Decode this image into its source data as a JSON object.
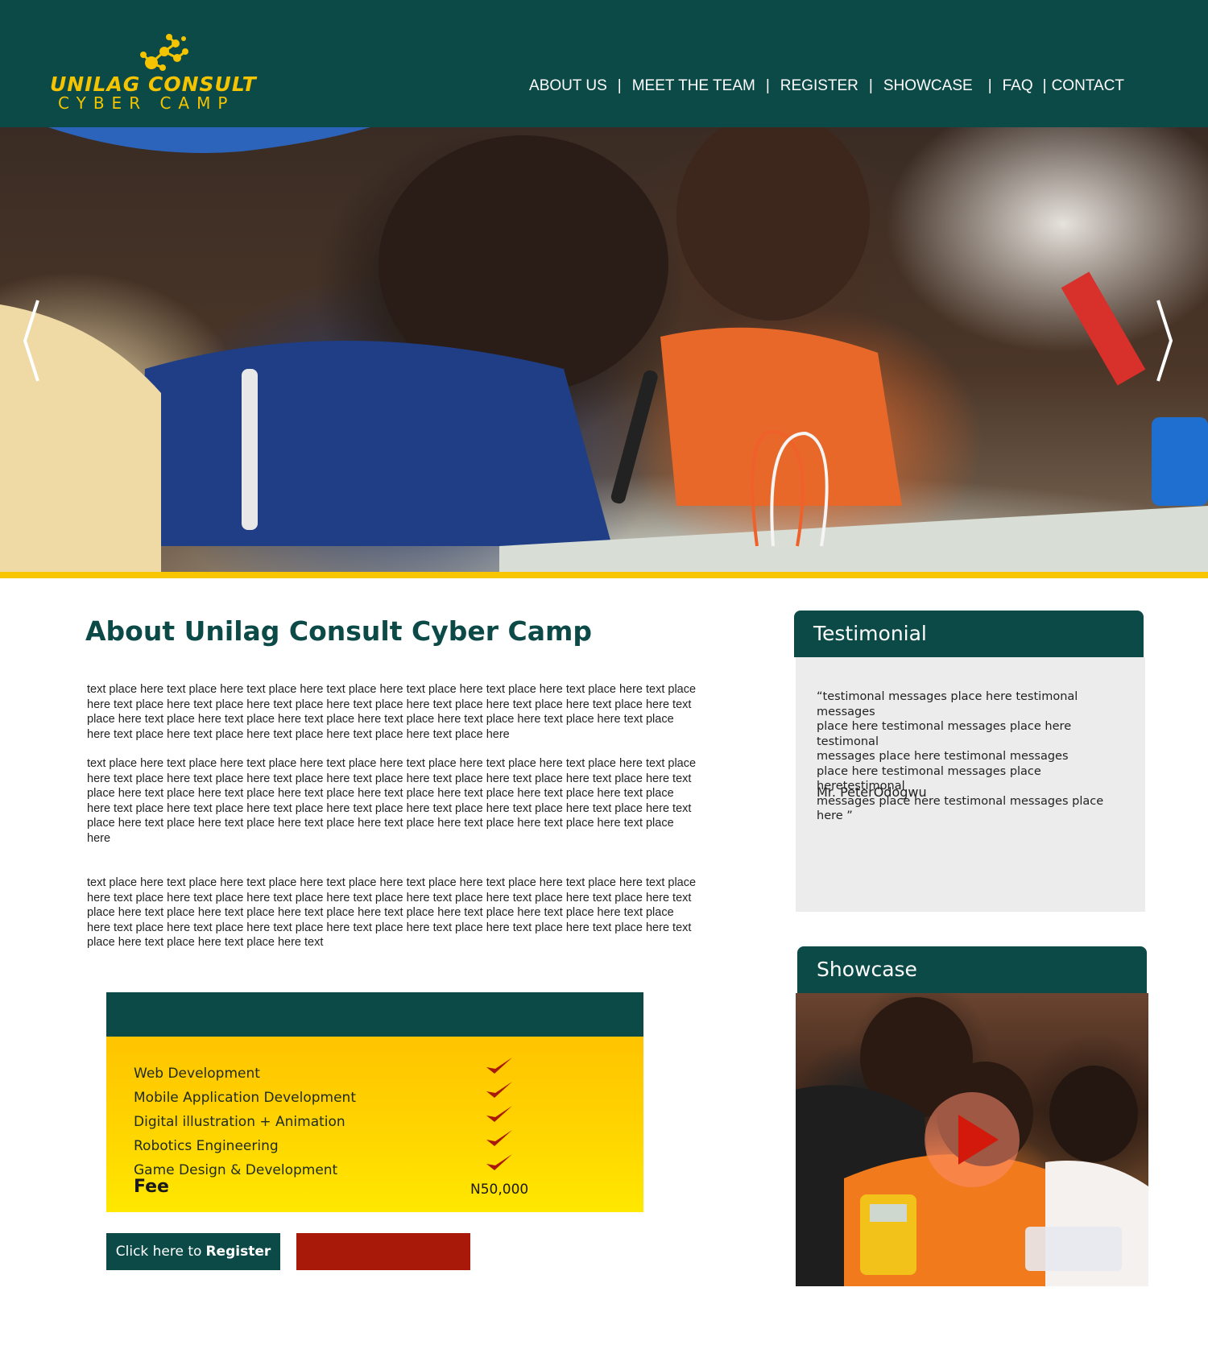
{
  "brand": {
    "line1": "UNILAG CONSULT",
    "line2": "CYBER CAMP",
    "color": "#f5c400"
  },
  "nav": {
    "items": [
      {
        "label": "ABOUT US"
      },
      {
        "label": "MEET THE TEAM"
      },
      {
        "label": "REGISTER"
      },
      {
        "label": "SHOWCASE"
      },
      {
        "label": "FAQ"
      },
      {
        "label": "CONTACT"
      }
    ],
    "separator": "|"
  },
  "hero": {
    "prev_icon": "chevron-left-icon",
    "next_icon": "chevron-right-icon"
  },
  "about": {
    "title_prefix": "About ",
    "title_strong": "Unilag Consult Cyber Camp",
    "paragraph1": "text place here text place here text place here text place here text place here text place here text place here text place here text place here text place here text place here text place here text place here text place here text place here text place here text place here text place here text place here text place here text place here text place here text place here text place here text place here text place here text place here text place here",
    "paragraph2": "text place here text place here text place here text place here text place here text place here text place here text place here text place here text place here text place here text place here text place here text place here text place here text place here text place here text place here text place here text place here text place here text place here text place here text place here text place here text place here text place here text place here text place here text place here text place here text place here text place here text place here text place here text place here text place here text place here",
    "paragraph3": "text place here text place here text place here text place here text place here text place here text place here text place here text place here text place here text place here text place here text place here text place here text place here text place here text place here text place here text place here text place here text place here text place here text place here text place here text place here text place here text place here text place here text place here text place here text place here text place here text place here text"
  },
  "courses": {
    "items": [
      {
        "label": "Web Development"
      },
      {
        "label": "Mobile Application Development"
      },
      {
        "label": "Digital illustration + Animation"
      },
      {
        "label": "Robotics Engineering"
      },
      {
        "label": "Game Design & Development"
      }
    ],
    "fee_label": "Fee",
    "fee_value": "N50,000",
    "check_color": "#a8190a"
  },
  "buttons": {
    "register_prefix": "Click here to",
    "register_strong": "Register"
  },
  "testimonial": {
    "title": "Testimonial",
    "quote": "“testimonal messages place here testimonal messages\nplace here testimonal messages place here testimonal\nmessages place here  testimonal messages\nplace here testimonal messages place heretestimonal\nmessages place here testimonal messages place here ”",
    "author": "Mr. PeterOdogwu"
  },
  "showcase": {
    "title": "Showcase",
    "play_icon": "play-icon"
  },
  "colors": {
    "primary": "#0c4a48",
    "accent_yellow": "#f7c600",
    "accent_red": "#a8190a",
    "panel_gray": "#ececec"
  }
}
